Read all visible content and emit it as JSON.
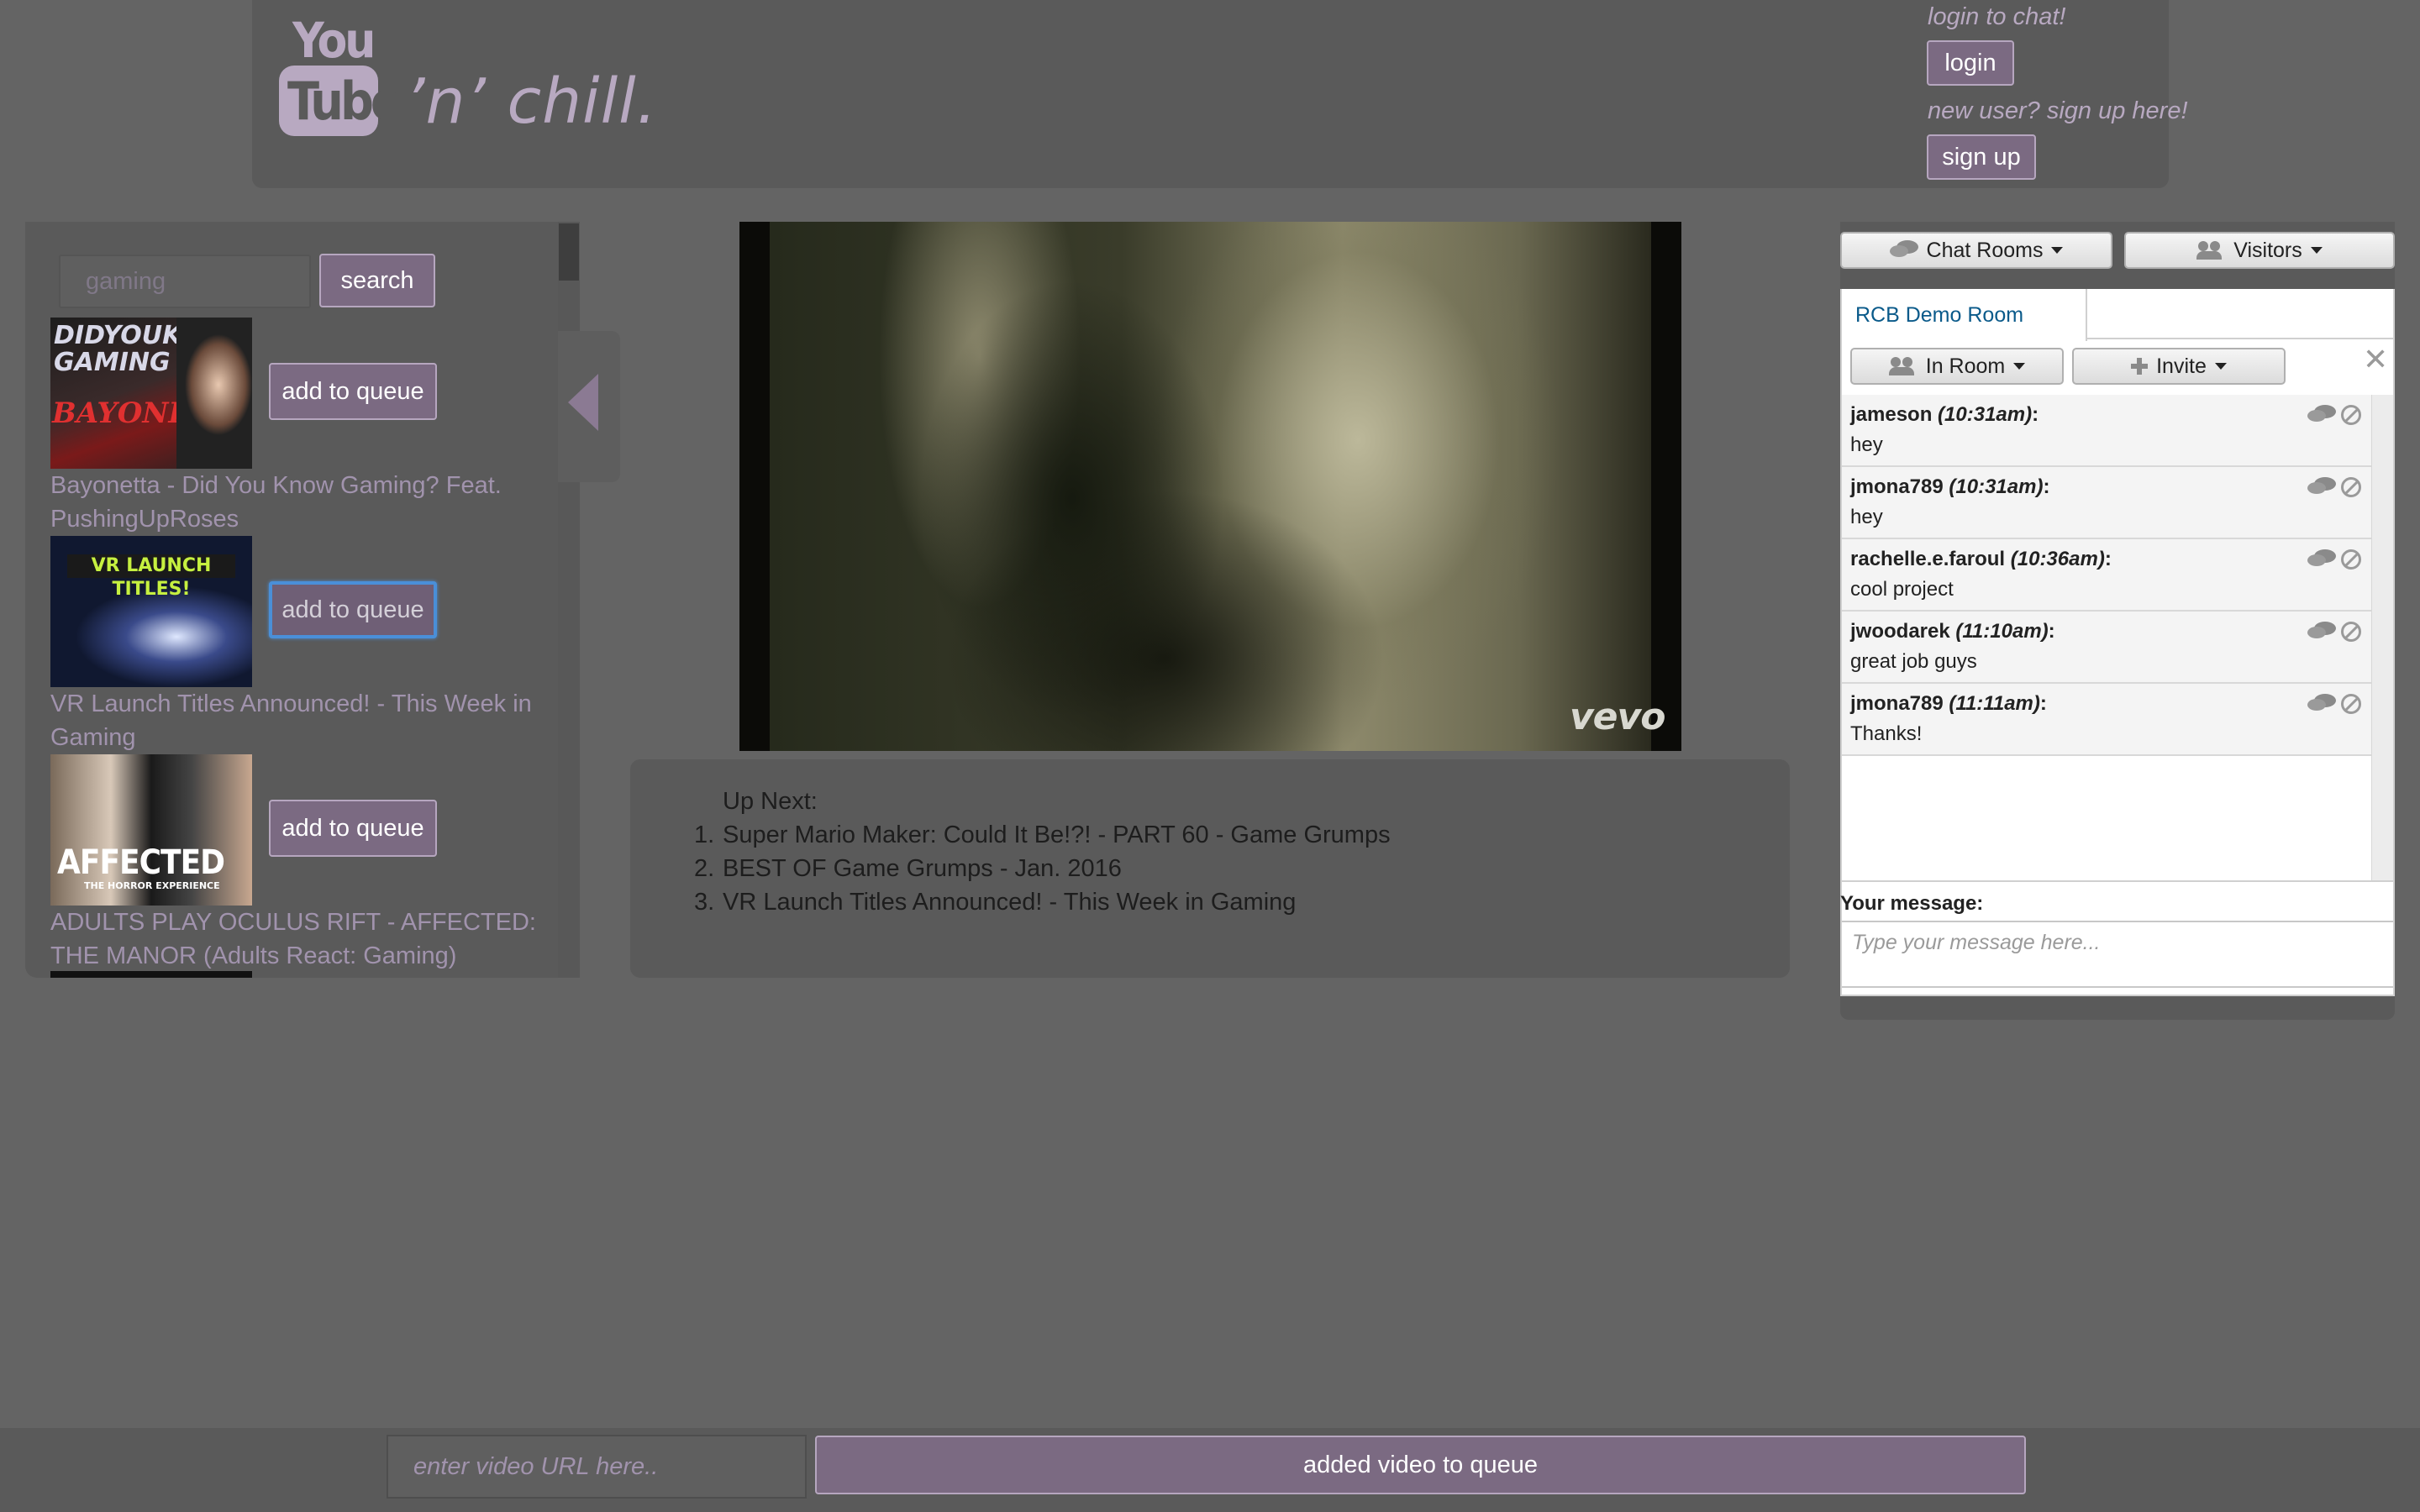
{
  "header": {
    "logo_text_top": "You",
    "logo_text_bottom": "Tube",
    "tagline": "’n’ chill.",
    "login_hint": "login to chat!",
    "login_label": "login",
    "signup_hint": "new user? sign up here!",
    "signup_label": "sign up"
  },
  "search": {
    "value": "gaming",
    "button_label": "search"
  },
  "results": [
    {
      "title": "Bayonetta - Did You Know Gaming? Feat. PushingUpRoses",
      "button_label": "add to queue",
      "thumb_text": "DID YOU KNOW GAMING BAYONETTA"
    },
    {
      "title": "VR Launch Titles Announced! - This Week in Gaming",
      "button_label": "add to queue",
      "thumb_text": "VR LAUNCH TITLES!"
    },
    {
      "title": "ADULTS PLAY OCULUS RIFT - AFFECTED: THE MANOR (Adults React: Gaming)",
      "button_label": "add to queue",
      "thumb_text": "AFFECTED THE HORROR EXPERIENCE"
    }
  ],
  "video": {
    "watermark": "vevo"
  },
  "up_next": {
    "title": "Up Next:",
    "items": [
      "Super Mario Maker: Could It Be!?! - PART 60 - Game Grumps",
      "BEST OF Game Grumps - Jan. 2016",
      "VR Launch Titles Announced! - This Week in Gaming"
    ]
  },
  "chat": {
    "chat_rooms_label": "Chat Rooms",
    "visitors_label": "Visitors",
    "room_tab": "RCB Demo Room",
    "in_room_label": "In Room",
    "invite_label": "Invite",
    "close_glyph": "✕",
    "messages": [
      {
        "user": "jameson",
        "time": "(10:31am)",
        "text": "hey"
      },
      {
        "user": "jmona789",
        "time": "(10:31am)",
        "text": "hey"
      },
      {
        "user": "rachelle.e.faroul",
        "time": "(10:36am)",
        "text": "cool project"
      },
      {
        "user": "jwoodarek",
        "time": "(11:10am)",
        "text": "great job guys"
      },
      {
        "user": "jmona789",
        "time": "(11:11am)",
        "text": "Thanks!"
      }
    ],
    "your_message_label": "Your message:",
    "message_placeholder": "Type your message here..."
  },
  "footer": {
    "url_placeholder": "enter video URL here..",
    "status_label": "added video to queue"
  },
  "colors": {
    "background": "#646464",
    "panel": "#5a5a5a",
    "accent_purple": "#7b6a82",
    "link_purple": "#a193ad",
    "logo": "#b8a9c1"
  }
}
